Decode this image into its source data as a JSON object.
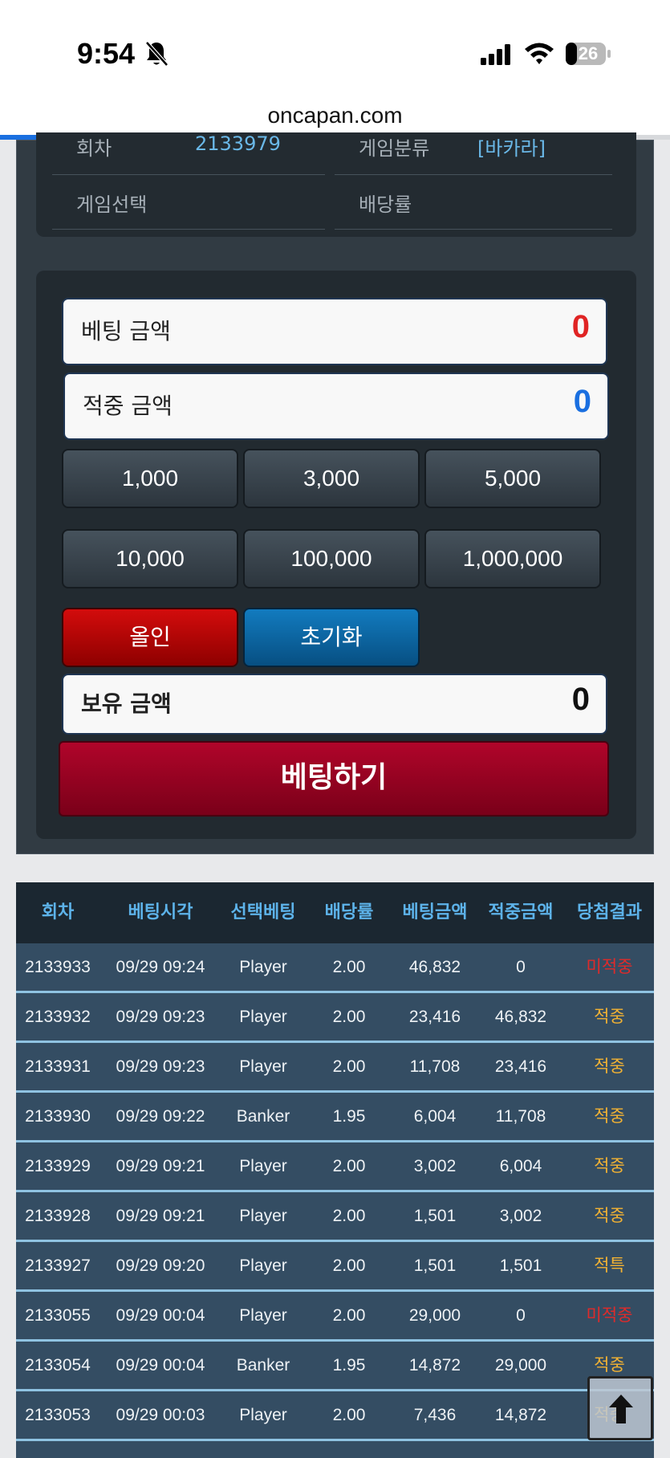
{
  "status_bar": {
    "time": "9:54",
    "battery": "26"
  },
  "browser": {
    "url": "oncapan.com",
    "load_progress": 0.9
  },
  "game_info": {
    "round_label": "회차",
    "round_value": "2133979",
    "category_label": "게임분류",
    "category_value": "[바카라]",
    "selection_label": "게임선택",
    "selection_value": "",
    "odds_label": "배당률",
    "odds_value": ""
  },
  "bet_form": {
    "bet_amount_label": "베팅 금액",
    "bet_amount_value": "0",
    "win_amount_label": "적중 금액",
    "win_amount_value": "0",
    "chips": [
      "1,000",
      "3,000",
      "5,000",
      "10,000",
      "100,000",
      "1,000,000"
    ],
    "allin_label": "올인",
    "reset_label": "초기화",
    "balance_label": "보유 금액",
    "balance_value": "0",
    "submit_label": "베팅하기"
  },
  "colors": {
    "bet_amount": "#e02424",
    "win_amount": "#1a6fe0",
    "win_result": "#f2b233",
    "lose_result": "#e02a2a"
  },
  "history": {
    "columns": [
      "회차",
      "베팅시각",
      "선택베팅",
      "배당률",
      "베팅금액",
      "적중금액",
      "당첨결과"
    ],
    "rows": [
      {
        "round": "2133933",
        "time": "09/29 09:24",
        "pick": "Player",
        "odds": "2.00",
        "bet": "46,832",
        "win": "0",
        "result": "미적중",
        "status": "lose"
      },
      {
        "round": "2133932",
        "time": "09/29 09:23",
        "pick": "Player",
        "odds": "2.00",
        "bet": "23,416",
        "win": "46,832",
        "result": "적중",
        "status": "win"
      },
      {
        "round": "2133931",
        "time": "09/29 09:23",
        "pick": "Player",
        "odds": "2.00",
        "bet": "11,708",
        "win": "23,416",
        "result": "적중",
        "status": "win"
      },
      {
        "round": "2133930",
        "time": "09/29 09:22",
        "pick": "Banker",
        "odds": "1.95",
        "bet": "6,004",
        "win": "11,708",
        "result": "적중",
        "status": "win"
      },
      {
        "round": "2133929",
        "time": "09/29 09:21",
        "pick": "Player",
        "odds": "2.00",
        "bet": "3,002",
        "win": "6,004",
        "result": "적중",
        "status": "win"
      },
      {
        "round": "2133928",
        "time": "09/29 09:21",
        "pick": "Player",
        "odds": "2.00",
        "bet": "1,501",
        "win": "3,002",
        "result": "적중",
        "status": "win"
      },
      {
        "round": "2133927",
        "time": "09/29 09:20",
        "pick": "Player",
        "odds": "2.00",
        "bet": "1,501",
        "win": "1,501",
        "result": "적특",
        "status": "win"
      },
      {
        "round": "2133055",
        "time": "09/29 00:04",
        "pick": "Player",
        "odds": "2.00",
        "bet": "29,000",
        "win": "0",
        "result": "미적중",
        "status": "lose"
      },
      {
        "round": "2133054",
        "time": "09/29 00:04",
        "pick": "Banker",
        "odds": "1.95",
        "bet": "14,872",
        "win": "29,000",
        "result": "적중",
        "status": "win"
      },
      {
        "round": "2133053",
        "time": "09/29 00:03",
        "pick": "Player",
        "odds": "2.00",
        "bet": "7,436",
        "win": "14,872",
        "result": "적중",
        "status": "win"
      }
    ]
  }
}
